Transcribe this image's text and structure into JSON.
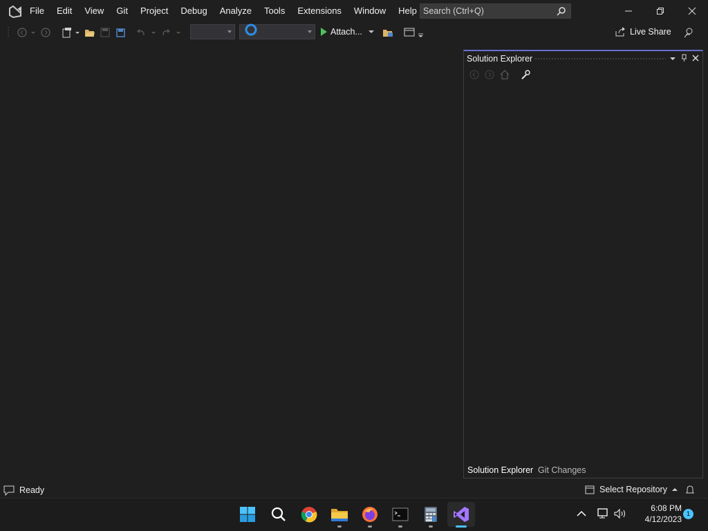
{
  "menu": [
    "File",
    "Edit",
    "View",
    "Git",
    "Project",
    "Debug",
    "Analyze",
    "Tools",
    "Extensions",
    "Window",
    "Help"
  ],
  "search": {
    "placeholder": "Search (Ctrl+Q)"
  },
  "toolbar": {
    "attach_label": "Attach...",
    "live_share_label": "Live Share"
  },
  "solution_explorer": {
    "title": "Solution Explorer",
    "tabs": [
      "Solution Explorer",
      "Git Changes"
    ]
  },
  "status": {
    "text": "Ready",
    "repository": "Select Repository"
  },
  "taskbar": {
    "time": "6:08 PM",
    "date": "4/12/2023",
    "notification_count": "1"
  },
  "colors": {
    "accent": "#6a6fd1",
    "background": "#1f1f1f",
    "vs_purple": "#a277ff"
  }
}
